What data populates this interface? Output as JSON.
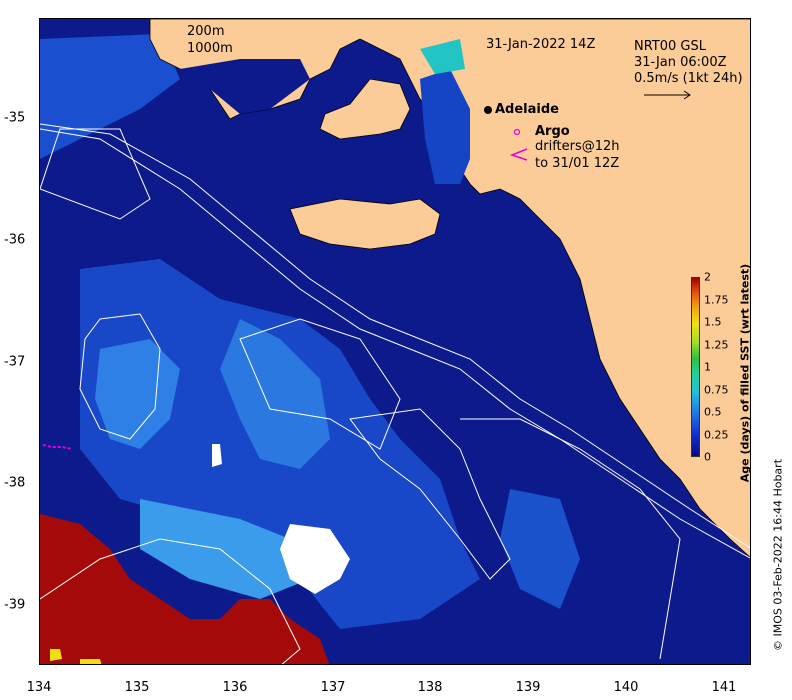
{
  "map": {
    "date_label": "31-Jan-2022 14Z",
    "legend_contours": [
      "200m",
      "1000m"
    ],
    "current_info": [
      "NRT00 GSL",
      "31-Jan 06:00Z",
      "0.5m/s (1kt 24h)"
    ],
    "place_label": "Adelaide",
    "argo_label": "Argo",
    "drifter_label_1": "drifters@12h",
    "drifter_label_2": "to 31/01 12Z",
    "x_ticks": [
      "134",
      "135",
      "136",
      "137",
      "138",
      "139",
      "140",
      "141"
    ],
    "y_ticks": [
      "-35",
      "-36",
      "-37",
      "-38",
      "-39"
    ],
    "colorbar": {
      "label": "Age (days) of filled SST (wrt latest)",
      "ticks": [
        "2",
        "1.75",
        "1.5",
        "1.25",
        "1",
        "0.75",
        "0.5",
        "0.25",
        "0"
      ]
    },
    "credit": "© IMOS 03-Feb-2022 16:44 Hobart",
    "colors": {
      "land": "#fbcb98",
      "ocean_deep": "#0c1a8c",
      "ocean_recent": "#1f5fd6",
      "old_data": "#a50a0a"
    }
  }
}
